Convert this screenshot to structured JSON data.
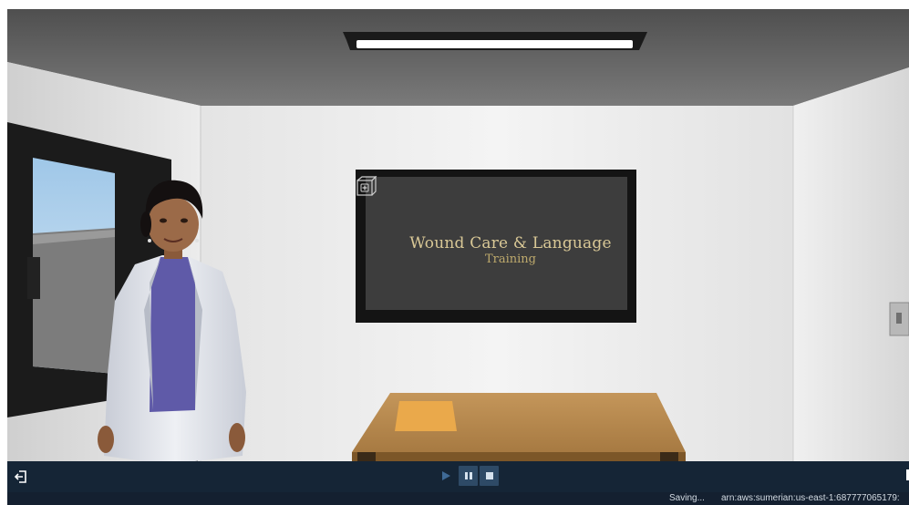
{
  "scene": {
    "board": {
      "title": "Wound Care & Language",
      "subtitle": "Training",
      "icon": "first-aid-box-icon"
    },
    "colors": {
      "ceiling": "#5c5c5c",
      "wall": "#eeeeee",
      "board_frame": "#141414",
      "board_surface": "#3c3c3c",
      "board_text": "#d9c896",
      "table_top": "#b98a4e",
      "folder": "#eaa94b",
      "coat": "#dfe3ea",
      "sweater": "#5f5aa8"
    }
  },
  "toolbar": {
    "exit_icon": "exit-door-icon",
    "play_icon": "play-icon",
    "pause_icon": "pause-icon",
    "stop_icon": "stop-icon",
    "background": "#152536",
    "button_background": "#2e4a66"
  },
  "status": {
    "saving": "Saving...",
    "arn": "arn:aws:sumerian:us-east-1:687777065179:"
  }
}
